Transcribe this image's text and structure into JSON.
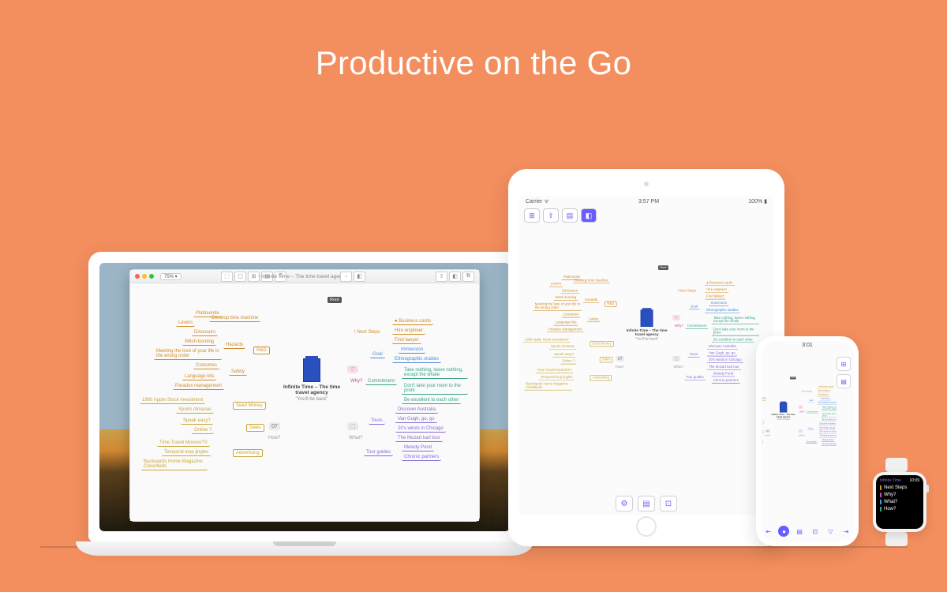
{
  "hero": {
    "title": "Productive on the Go"
  },
  "mac": {
    "window_title": "~  Infinite Time – The time travel agency  ~",
    "zoom": "75% ▾",
    "toolbar_icons": [
      "⬚",
      "▢",
      "⊞",
      "▤",
      "⍰"
    ],
    "toolbar_mid": [
      "▫",
      "◧"
    ],
    "toolbar_right": [
      "⇪",
      "⬚",
      "◧",
      "⧉"
    ]
  },
  "mindmap": {
    "center_title": "Infinite Time – The time travel agency",
    "center_subtitle": "\"You'll be back\"",
    "root_tag": "Root",
    "plus_tag": "+",
    "left": {
      "rd": {
        "label": "R&D",
        "children": {
          "levers": "Levers",
          "platinumite": "Platinumite",
          "develop": "Develop time machine",
          "hazards": "Hazards",
          "dinosaurs": "Dinosaurs",
          "witch": "Witch-burning",
          "meeting_love": "Meeting the love of your life in the wrong order",
          "safety": "Safety",
          "costumes": "Costumes",
          "language": "Language kits",
          "paradox": "Paradox management"
        }
      },
      "seed": {
        "label": "Seed Money",
        "children": {
          "apple": "1980 Apple Stock investment",
          "almanac": "Sports Almanac"
        }
      },
      "sales": {
        "label": "Sales",
        "children": {
          "speak": "Speak easy?",
          "online": "Online ?"
        }
      },
      "advertising": {
        "label": "Advertising",
        "children": {
          "movies": "Time Travel Movies/TV",
          "jingles": "Temporal loop jingles",
          "magazine": "Backwards Home Magazine Classifieds"
        }
      },
      "how": "How?"
    },
    "right": {
      "next_steps": {
        "label": "Next Steps",
        "icon": "!",
        "children": {
          "biz_cards": "Business cards",
          "hire_eng": "Hire engineer",
          "find_lawyer": "Find lawyer"
        }
      },
      "why": "Why?",
      "goal": {
        "label": "Goal",
        "children": {
          "immersion": "Immersion",
          "ethno": "Ethnographic studies"
        }
      },
      "commitment": {
        "label": "Commitment",
        "children": {
          "take_nothing": "Take nothing, leave nothing, except the whale",
          "mom": "Don't take your mom to the prom",
          "excellent": "Be excellent to each other"
        }
      },
      "tours": {
        "label": "Tours",
        "children": {
          "aus": "Discover Australia",
          "vangogh": "Van Gogh, go, go",
          "chicago": "20's winds in Chicago",
          "mozart": "The Mozart karl tour"
        }
      },
      "what": "What?",
      "guides": {
        "label": "Tour guides",
        "children": {
          "melody": "Melody Pond",
          "chronic": "Chronic partners"
        }
      }
    }
  },
  "ipad": {
    "status_left": "Carrier  ᯤ",
    "status_center": "3:57 PM",
    "status_right": "100% ▮",
    "toolbar": [
      "⊞",
      "⇪",
      "▤",
      "◧"
    ],
    "bottom": [
      "⚙",
      "▤",
      "⊡"
    ]
  },
  "iphone": {
    "time": "3:01",
    "side_buttons": [
      "⊞",
      "▤"
    ],
    "bottom": [
      "⇤",
      "●",
      "▤",
      "⊡",
      "▽",
      "⇥"
    ]
  },
  "watch": {
    "title": "Infinite Time",
    "time": "10:09",
    "items": [
      {
        "label": "Next Steps",
        "color": "#d08c2a"
      },
      {
        "label": "Why?",
        "color": "#c24f9c"
      },
      {
        "label": "What?",
        "color": "#3a9de0"
      },
      {
        "label": "How?",
        "color": "#3ba28c"
      }
    ]
  }
}
